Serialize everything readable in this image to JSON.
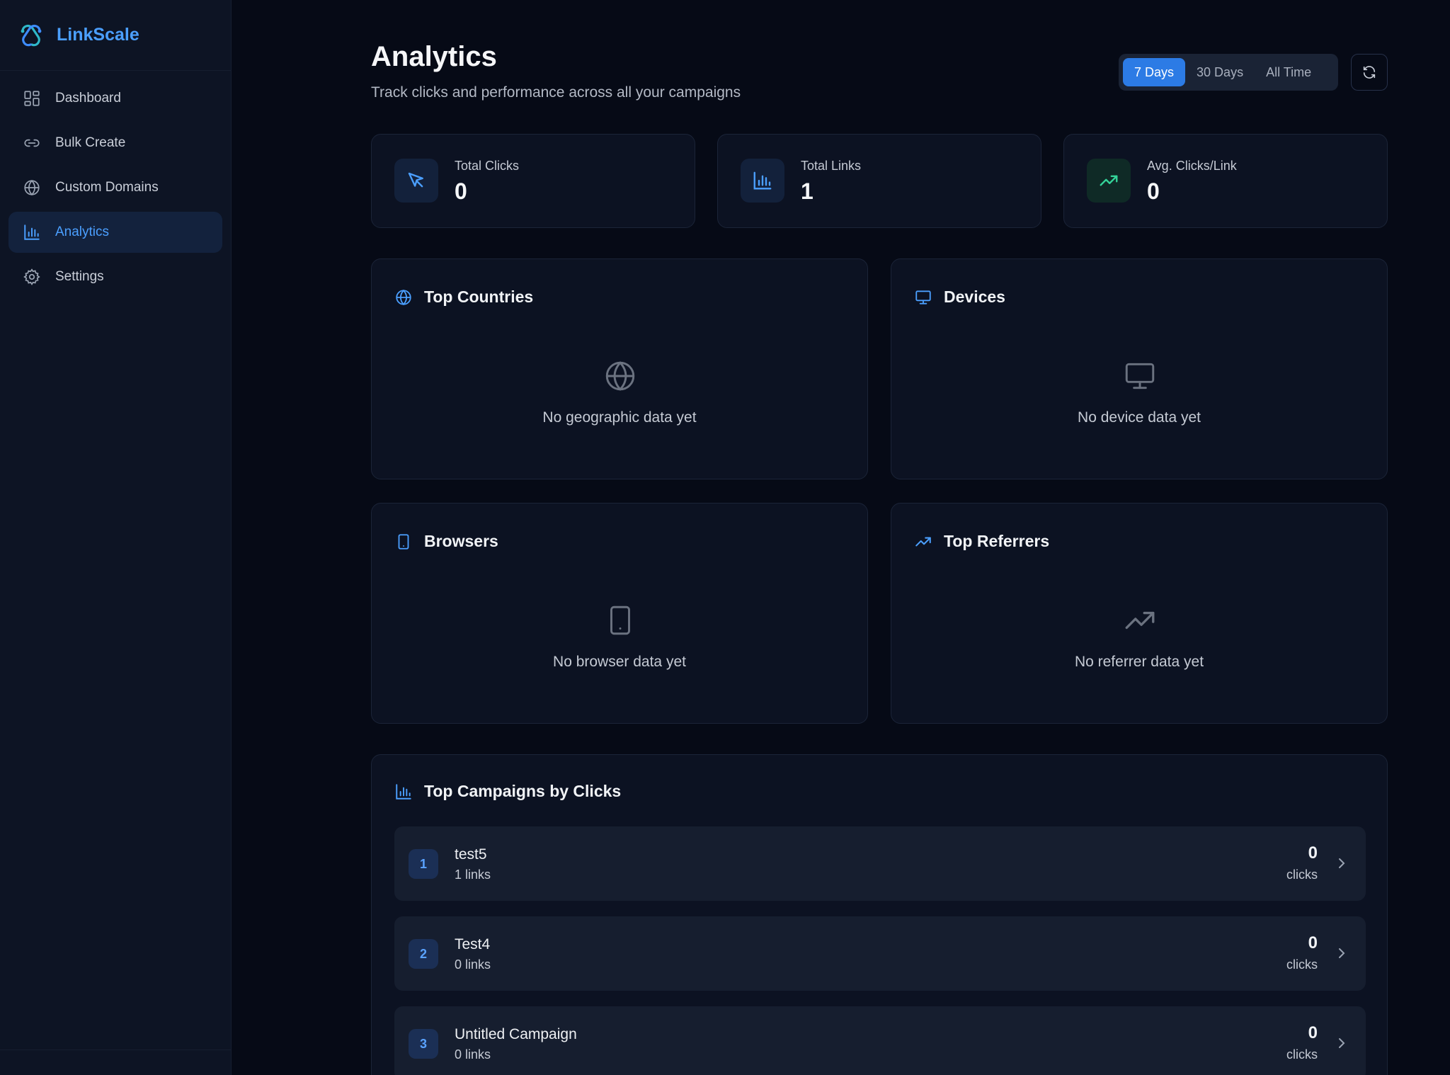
{
  "brand": {
    "name": "LinkScale"
  },
  "sidebar": {
    "items": [
      {
        "label": "Dashboard",
        "icon": "dashboard-icon",
        "active": false
      },
      {
        "label": "Bulk Create",
        "icon": "link-icon",
        "active": false
      },
      {
        "label": "Custom Domains",
        "icon": "globe-icon",
        "active": false
      },
      {
        "label": "Analytics",
        "icon": "bar-chart-icon",
        "active": true
      },
      {
        "label": "Settings",
        "icon": "gear-icon",
        "active": false
      }
    ]
  },
  "header": {
    "title": "Analytics",
    "subtitle": "Track clicks and performance across all your campaigns"
  },
  "range": {
    "options": [
      "7 Days",
      "30 Days",
      "All Time"
    ],
    "selected": "7 Days"
  },
  "stats": [
    {
      "label": "Total Clicks",
      "value": "0",
      "icon": "cursor-icon"
    },
    {
      "label": "Total Links",
      "value": "1",
      "icon": "bar-chart-icon"
    },
    {
      "label": "Avg. Clicks/Link",
      "value": "0",
      "icon": "trending-up-icon"
    }
  ],
  "panels": {
    "countries": {
      "title": "Top Countries",
      "empty": "No geographic data yet",
      "icon": "globe-icon"
    },
    "devices": {
      "title": "Devices",
      "empty": "No device data yet",
      "icon": "monitor-icon"
    },
    "browsers": {
      "title": "Browsers",
      "empty": "No browser data yet",
      "icon": "tablet-icon"
    },
    "referrers": {
      "title": "Top Referrers",
      "empty": "No referrer data yet",
      "icon": "trending-up-icon"
    }
  },
  "campaigns": {
    "title": "Top Campaigns by Clicks",
    "clicks_label": "clicks",
    "rows": [
      {
        "rank": "1",
        "name": "test5",
        "links": "1 links",
        "clicks": "0"
      },
      {
        "rank": "2",
        "name": "Test4",
        "links": "0 links",
        "clicks": "0"
      },
      {
        "rank": "3",
        "name": "Untitled Campaign",
        "links": "0 links",
        "clicks": "0"
      }
    ]
  },
  "colors": {
    "accent": "#4b9fff",
    "background": "#060a16",
    "sidebar": "#0d1424",
    "card": "#0c1222",
    "success": "#34d399"
  }
}
